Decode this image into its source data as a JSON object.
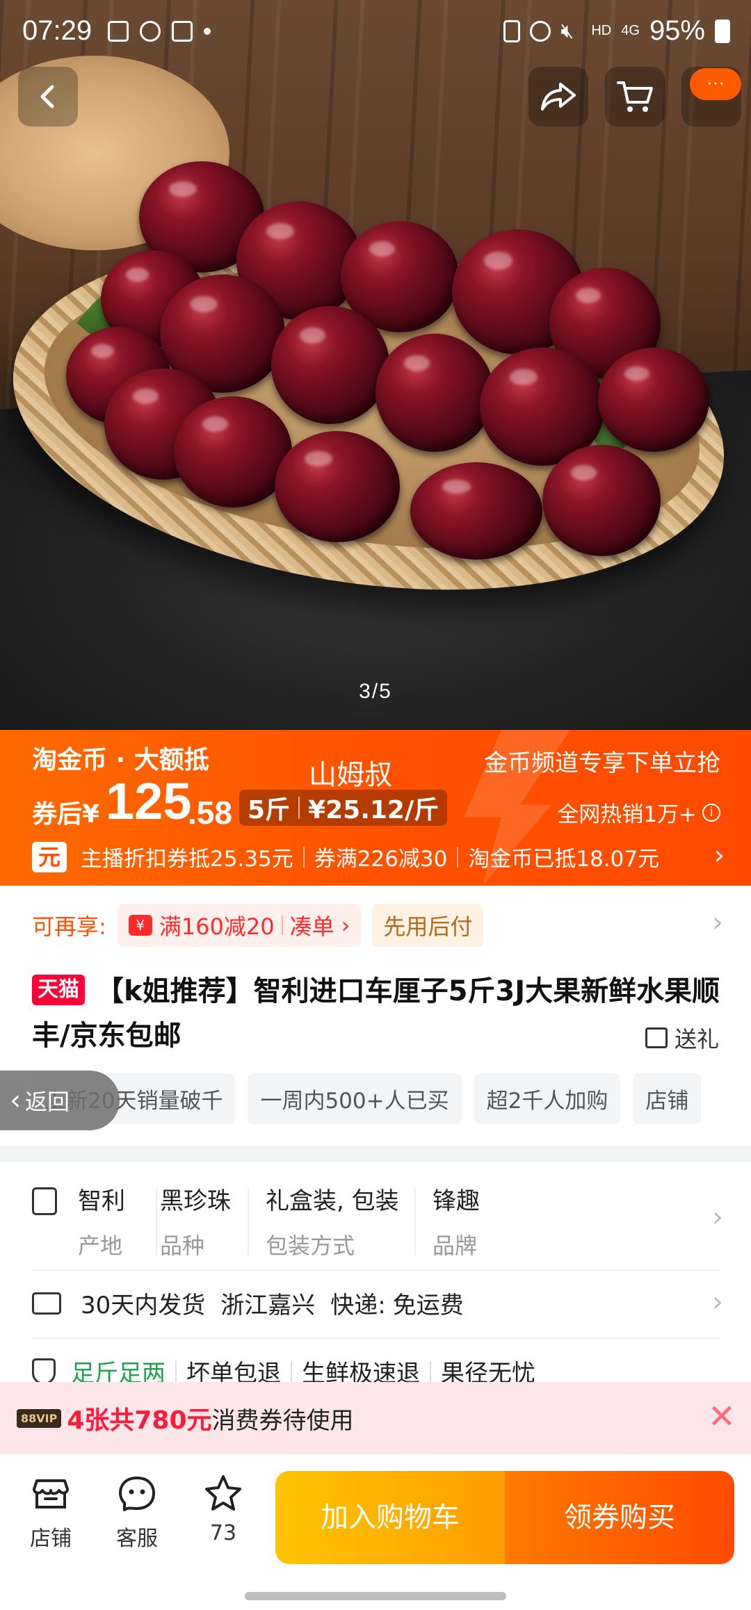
{
  "status_bar": {
    "time": "07:29",
    "network": "HD",
    "signal": "4G",
    "battery": "95%"
  },
  "gallery": {
    "counter": "3/5"
  },
  "top_nav": {
    "more_label": "···"
  },
  "price_banner": {
    "tag": "淘金币 · 大额抵",
    "after_label": "券后¥",
    "price_int": "125",
    "price_dec": ".58",
    "anchor_name": "山姆叔",
    "unit_weight": "5斤",
    "unit_price": "¥25.12/斤",
    "promo_text": "金币频道专享下单立抢",
    "hot_text": "全网热销1万+",
    "yuan_badge": "元",
    "deals": [
      "主播折扣券抵25.35元",
      "券满226减30",
      "淘金币已抵18.07元"
    ]
  },
  "coupons": {
    "label": "可再享:",
    "discount": "满160减20",
    "combine": "凑单",
    "pay_later": "先用后付"
  },
  "product": {
    "badge": "天猫",
    "title": "【k姐推荐】智利进口车厘子5斤3J大果新鲜水果顺丰/京东包邮",
    "gift": "送礼"
  },
  "highlights": [
    "上新20天销量破千",
    "一周内500+人已买",
    "超2千人加购",
    "店铺"
  ],
  "back_float": "返回",
  "attributes": [
    {
      "value": "智利",
      "key": "产地"
    },
    {
      "value": "黑珍珠",
      "key": "品种"
    },
    {
      "value": "礼盒装, 包装",
      "key": "包装方式"
    },
    {
      "value": "锋趣",
      "key": "品牌"
    }
  ],
  "shipping": {
    "time": "30天内发货",
    "origin": "浙江嘉兴",
    "express_label": "快递:",
    "fee": "免运费"
  },
  "guarantees": [
    "足斤足两",
    "坏单包退",
    "生鲜极速退",
    "果径无忧"
  ],
  "voucher_bar": {
    "vip": "88VIP",
    "highlight": "4张共780元",
    "text": "消费券待使用"
  },
  "bottom_bar": {
    "shop": "店铺",
    "service": "客服",
    "favorites": "73",
    "add_to_cart": "加入购物车",
    "buy": "领券购买"
  },
  "colors": {
    "accent": "#ff5000",
    "tmall_red": "#ff0036",
    "cart_yellow": "#ffc400"
  }
}
